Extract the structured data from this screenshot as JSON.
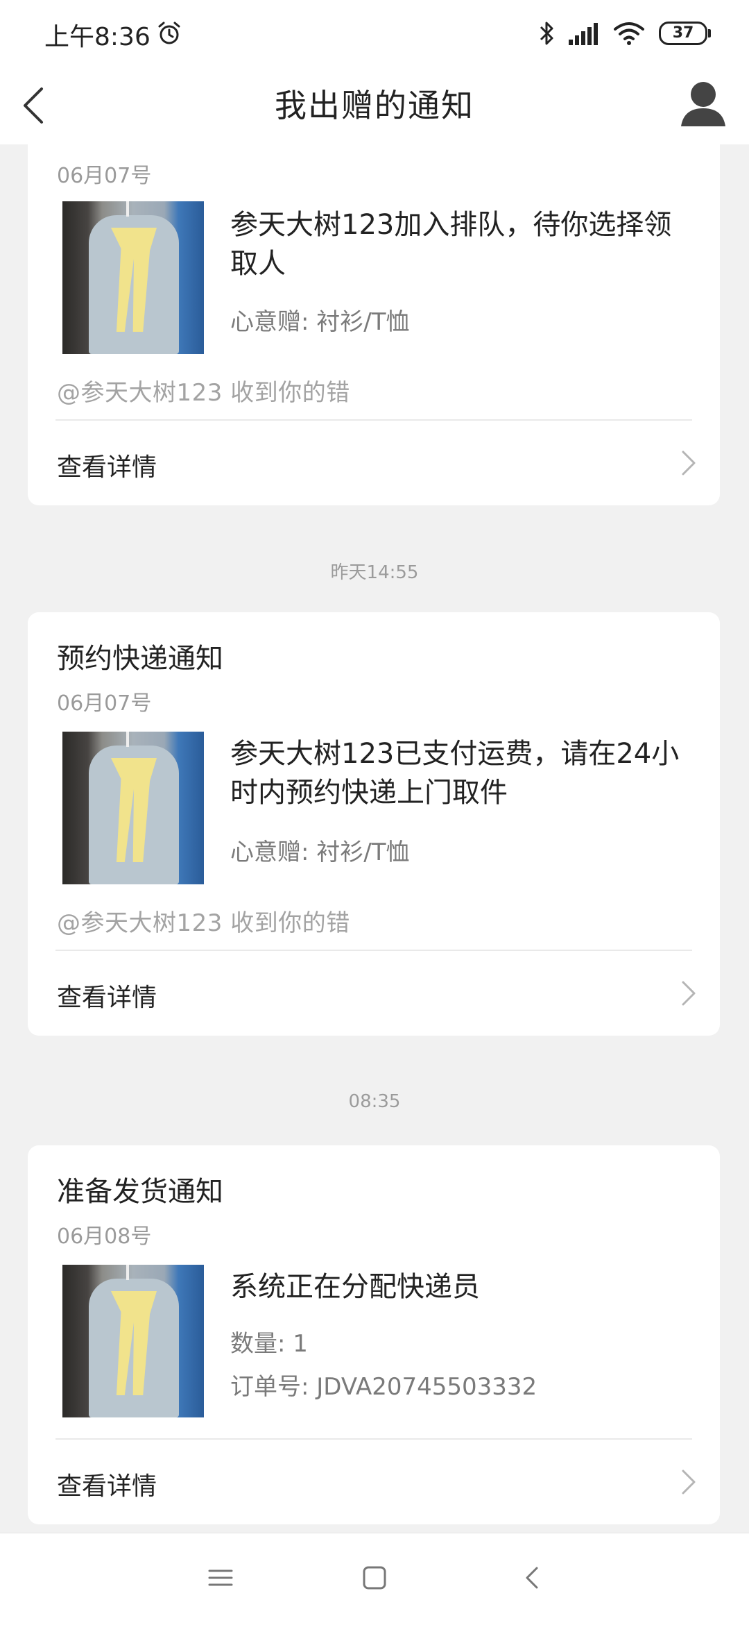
{
  "status_bar": {
    "time": "上午8:36",
    "battery": "37",
    "icons": [
      "alarm-icon",
      "bluetooth-icon",
      "signal-icon",
      "wifi-icon",
      "battery-icon"
    ]
  },
  "nav": {
    "title": "我出赠的通知",
    "icons": [
      "back-icon",
      "profile-icon"
    ]
  },
  "cards": [
    {
      "title": "",
      "date": "06月07号",
      "main_text": "参天大树123加入排队，待你选择领取人",
      "sub_lines": [
        "心意赠: 衬衫/T恤"
      ],
      "mention": "@参天大树123  收到你的错",
      "detail_label": "查看详情"
    },
    {
      "title": "预约快递通知",
      "date": "06月07号",
      "main_text": "参天大树123已支付运费，请在24小时内预约快递上门取件",
      "sub_lines": [
        "心意赠: 衬衫/T恤"
      ],
      "mention": "@参天大树123  收到你的错",
      "detail_label": "查看详情"
    },
    {
      "title": "准备发货通知",
      "date": "06月08号",
      "main_text": "系统正在分配快递员",
      "sub_lines": [
        "数量: 1",
        "订单号: JDVA20745503332"
      ],
      "mention": "",
      "detail_label": "查看详情"
    }
  ],
  "timestamps": [
    "昨天14:55",
    "08:35"
  ],
  "bottom_nav": {
    "icons": [
      "menu-icon",
      "home-square-icon",
      "back-triangle-icon"
    ]
  }
}
